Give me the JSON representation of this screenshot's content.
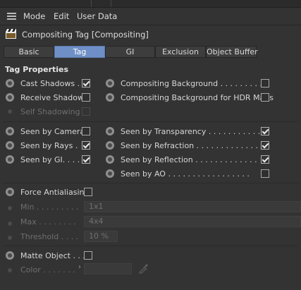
{
  "menu": {
    "items": [
      "Mode",
      "Edit",
      "User Data"
    ]
  },
  "header": {
    "title": "Compositing Tag [Compositing]",
    "icon": "clapperboard-icon"
  },
  "tabs": [
    {
      "label": "Basic",
      "active": false
    },
    {
      "label": "Tag",
      "active": true
    },
    {
      "label": "GI",
      "active": false
    },
    {
      "label": "Exclusion",
      "active": false
    },
    {
      "label": "Object Buffer",
      "active": false
    }
  ],
  "section": {
    "title": "Tag Properties"
  },
  "shadows": {
    "cast": {
      "label": "Cast Shadows .",
      "checked": true
    },
    "receive": {
      "label": "Receive Shadows",
      "checked": false
    },
    "self": {
      "label": "Self Shadowing",
      "checked": false,
      "disabled": true
    }
  },
  "compositing_bg": {
    "label": "Compositing Background . . . . . . . . .",
    "checked": false
  },
  "compositing_bg_hdr": {
    "label": "Compositing Background for HDR Maps",
    "checked": false
  },
  "seen_left": [
    {
      "label": "Seen by Camera",
      "checked": false
    },
    {
      "label": "Seen by Rays .",
      "checked": true
    },
    {
      "label": "Seen by GI. . . .",
      "checked": true
    }
  ],
  "seen_right": [
    {
      "label": "Seen by Transparency . . . . . . . . . . . .",
      "checked": true
    },
    {
      "label": "Seen by Refraction . . . . . . . . . . . . .",
      "checked": true
    },
    {
      "label": "Seen by Reflection . . . . . . . . . . . . .",
      "checked": true
    },
    {
      "label": "Seen by AO . . . . . . . . . . . . . . . . .",
      "checked": false
    }
  ],
  "antialiasing": {
    "label": "Force Antialiasing",
    "checked": false,
    "min": {
      "label": "Min . . . . . . . . .",
      "value": "1x1"
    },
    "max": {
      "label": "Max . . . . . . . .",
      "value": "4x4"
    },
    "threshold": {
      "label": "Threshold . . . .",
      "value": "10 %"
    }
  },
  "matte": {
    "label": "Matte Object . . .",
    "checked": false,
    "color_label": "Color . . . . . . ."
  },
  "colors": {
    "background": "#333333",
    "tab_active": "#6f90c6",
    "text": "#d6d6d6",
    "text_disabled": "#6e6e6e"
  }
}
